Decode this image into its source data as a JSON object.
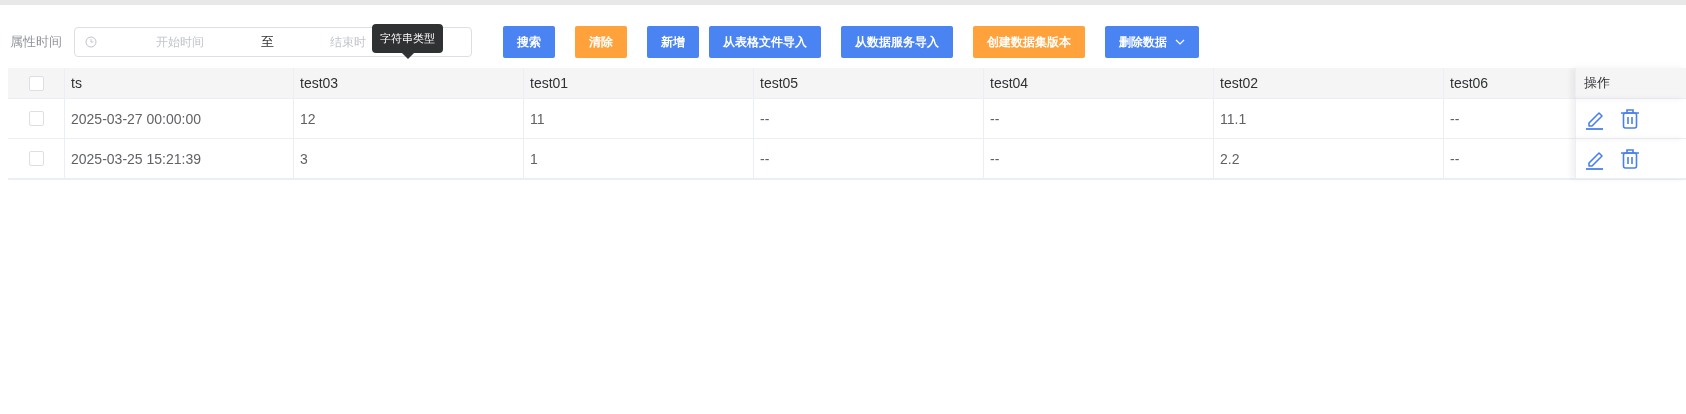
{
  "filter": {
    "label": "属性时间",
    "start_placeholder": "开始时间",
    "separator": "至",
    "end_placeholder": "结束时"
  },
  "tooltip": "字符串类型",
  "buttons": [
    {
      "label": "搜索",
      "kind": "primary"
    },
    {
      "label": "清除",
      "kind": "warning"
    },
    {
      "label": "新增",
      "kind": "primary"
    },
    {
      "label": "从表格文件导入",
      "kind": "primary"
    },
    {
      "label": "从数据服务导入",
      "kind": "primary"
    },
    {
      "label": "创建数据集版本",
      "kind": "warning"
    },
    {
      "label": "删除数据",
      "kind": "dropdown"
    }
  ],
  "table": {
    "header_checked": false,
    "columns": [
      "ts",
      "test03",
      "test01",
      "test05",
      "test04",
      "test02",
      "test06",
      "操作"
    ],
    "rows": [
      {
        "checked": false,
        "cells": [
          "2025-03-27 00:00:00",
          "12",
          "11",
          "--",
          "--",
          "11.1",
          "--"
        ]
      },
      {
        "checked": false,
        "cells": [
          "2025-03-25 15:21:39",
          "3",
          "1",
          "--",
          "--",
          "2.2",
          "--"
        ]
      }
    ]
  }
}
